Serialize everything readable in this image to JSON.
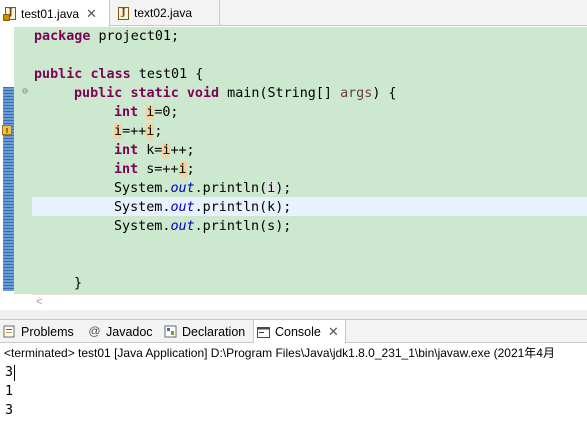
{
  "editor_tabs": [
    {
      "label": "test01.java",
      "active": true,
      "icon": "java-file-icon",
      "close_glyph": "✕"
    },
    {
      "label": "text02.java",
      "active": false,
      "icon": "java-file-icon"
    }
  ],
  "editor": {
    "line_1": {
      "kw": "package",
      "rest": " project01;"
    },
    "line_2": {
      "kw1": "public",
      "kw2": "class",
      "rest": " test01 {"
    },
    "line_3": {
      "kw1": "public",
      "kw2": "static",
      "kw3": "void",
      "mid": " main(String[] ",
      "param": "args",
      "rest": ") {"
    },
    "line_4": {
      "kw": "int",
      "var": "i",
      "rest": "=0;"
    },
    "line_5": {
      "var": "i",
      "mid": "=++",
      "var2": "i",
      "rest": ";"
    },
    "line_6": {
      "kw": "int",
      "pre": " k=",
      "var": "i",
      "rest": "++;"
    },
    "line_7": {
      "kw": "int",
      "pre": " s=++",
      "var": "i",
      "rest": ";"
    },
    "line_8": {
      "pre": "System.",
      "field": "out",
      "mid": ".println(",
      "var": "i",
      "rest": ");"
    },
    "line_9": {
      "pre": "System.",
      "field": "out",
      "mid": ".println(k);"
    },
    "line_10": {
      "pre": "System.",
      "field": "out",
      "mid": ".println(s);"
    },
    "line_11": {
      "text": "}"
    },
    "fold_glyph": "⊖",
    "scroll_left_glyph": "<"
  },
  "view_tabs": [
    {
      "label": "Problems",
      "icon": "problems-icon",
      "active": false
    },
    {
      "label": "Javadoc",
      "icon": "at-sign-icon",
      "active": false
    },
    {
      "label": "Declaration",
      "icon": "declaration-icon",
      "active": false
    },
    {
      "label": "Console",
      "icon": "console-icon",
      "active": true,
      "close_glyph": "✕"
    }
  ],
  "console": {
    "header": "<terminated> test01 [Java Application] D:\\Program Files\\Java\\jdk1.8.0_231_1\\bin\\javaw.exe (2021年4月",
    "output": [
      "3",
      "1",
      "3"
    ]
  },
  "colors": {
    "editor_background": "#cce8cf",
    "keyword": "#7f0055",
    "static_field": "#0000c0",
    "occurrence_highlight": "#f5d3a0",
    "current_line": "#e8f2fe"
  }
}
